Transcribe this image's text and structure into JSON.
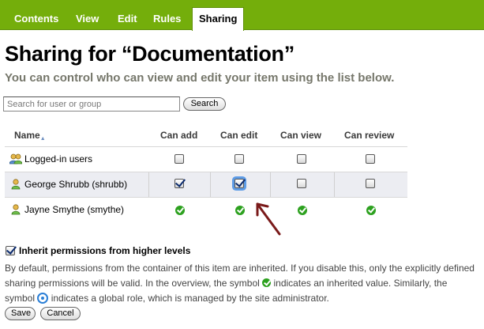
{
  "tabs": [
    {
      "label": "Contents"
    },
    {
      "label": "View"
    },
    {
      "label": "Edit"
    },
    {
      "label": "Rules"
    },
    {
      "label": "Sharing",
      "active": true
    }
  ],
  "page": {
    "title": "Sharing for “Documentation”",
    "subtitle": "You can control who can view and edit your item using the list below."
  },
  "search": {
    "placeholder": "Search for user or group",
    "button_label": "Search"
  },
  "table": {
    "headers": {
      "name": "Name",
      "sort_indicator": "▲",
      "can_add": "Can add",
      "can_edit": "Can edit",
      "can_view": "Can view",
      "can_review": "Can review"
    },
    "rows": [
      {
        "name": "Logged-in users",
        "icon": "group-icon",
        "add": "unchecked",
        "edit": "unchecked",
        "view": "unchecked",
        "review": "unchecked"
      },
      {
        "name": "George Shrubb (shrubb)",
        "icon": "user-icon",
        "add": "checked",
        "edit": "checked-focused",
        "view": "unchecked",
        "review": "unchecked"
      },
      {
        "name": "Jayne Smythe (smythe)",
        "icon": "user-icon",
        "add": "inherited",
        "edit": "inherited",
        "view": "inherited",
        "review": "inherited"
      }
    ]
  },
  "inherit": {
    "label": "Inherit permissions from higher levels",
    "checked": true,
    "description_part1": "By default, permissions from the container of this item are inherited. If you disable this, only the explicitly defined sharing permissions will be valid. In the overview, the symbol",
    "description_part2": "indicates an inherited value. Similarly, the symbol",
    "description_part3": "indicates a global role, which is managed by the site administrator."
  },
  "buttons": {
    "save": "Save",
    "cancel": "Cancel"
  },
  "colors": {
    "tab_bar": "#74ae0b",
    "subtitle": "#76776b",
    "alt_row": "#ecedf2",
    "inherited_check": "#2da11f",
    "global_role": "#2b7fd6",
    "annotation_arrow": "#7a1a1a"
  }
}
